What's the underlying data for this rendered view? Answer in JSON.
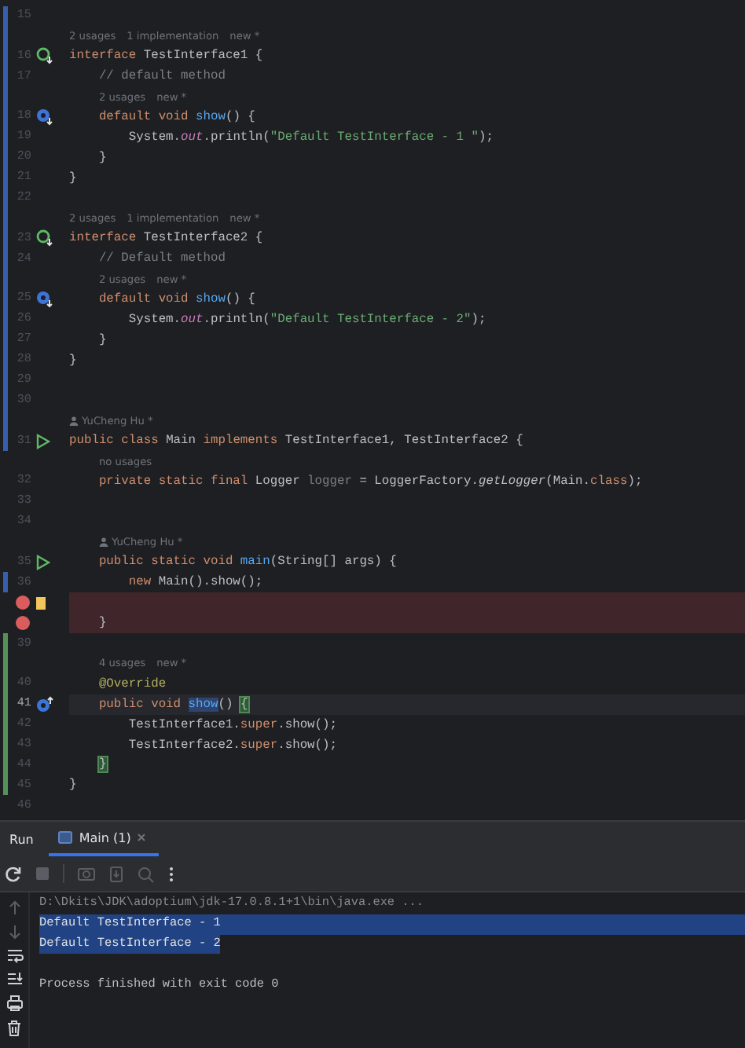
{
  "editor": {
    "lines": [
      {
        "number": "15",
        "modified": true
      },
      {
        "number": "16",
        "modified": true,
        "gutter": {
          "kind": "implemented"
        },
        "hints": [
          {
            "kind": "usage",
            "text": "2 usages"
          },
          {
            "kind": "usage",
            "text": "1 implementation"
          },
          {
            "kind": "usage",
            "text": "new *"
          }
        ],
        "tokens": [
          {
            "text": "interface",
            "kind": "keyword"
          },
          {
            "text": " TestInterface1 {",
            "kind": "plain"
          }
        ]
      },
      {
        "number": "17",
        "modified": true,
        "tokens": [
          {
            "text": "    // default method",
            "kind": "comment"
          }
        ]
      },
      {
        "number": "18",
        "modified": true,
        "gutter": {
          "kind": "method-implemented"
        },
        "hints": [
          {
            "kind": "usage",
            "text": "2 usages"
          },
          {
            "kind": "usage",
            "text": "new *"
          }
        ],
        "tokens": [
          {
            "text": "    default void ",
            "kind": "keyword"
          },
          {
            "text": "show",
            "kind": "declaration"
          },
          {
            "text": "() {",
            "kind": "plain"
          }
        ]
      },
      {
        "number": "19",
        "modified": true,
        "tokens": [
          {
            "text": "        System.",
            "kind": "plain"
          },
          {
            "text": "out",
            "kind": "field"
          },
          {
            "text": ".println(",
            "kind": "plain"
          },
          {
            "text": "\"Default TestInterface - 1 \"",
            "kind": "string"
          },
          {
            "text": ");",
            "kind": "plain"
          }
        ]
      },
      {
        "number": "20",
        "modified": true,
        "tokens": [
          {
            "text": "    }",
            "kind": "plain"
          }
        ]
      },
      {
        "number": "21",
        "modified": true,
        "tokens": [
          {
            "text": "}",
            "kind": "plain"
          }
        ]
      },
      {
        "number": "22",
        "modified": true
      },
      {
        "number": "23",
        "modified": true,
        "gutter": {
          "kind": "implemented"
        },
        "hints": [
          {
            "kind": "usage",
            "text": "2 usages"
          },
          {
            "kind": "usage",
            "text": "1 implementation"
          },
          {
            "kind": "usage",
            "text": "new *"
          }
        ],
        "tokens": [
          {
            "text": "interface",
            "kind": "keyword"
          },
          {
            "text": " TestInterface2 {",
            "kind": "plain"
          }
        ]
      },
      {
        "number": "24",
        "modified": true,
        "tokens": [
          {
            "text": "    // Default method",
            "kind": "comment"
          }
        ]
      },
      {
        "number": "25",
        "modified": true,
        "gutter": {
          "kind": "method-implemented"
        },
        "hints": [
          {
            "kind": "usage",
            "text": "2 usages"
          },
          {
            "kind": "usage",
            "text": "new *"
          }
        ],
        "tokens": [
          {
            "text": "    default void ",
            "kind": "keyword"
          },
          {
            "text": "show",
            "kind": "declaration"
          },
          {
            "text": "() {",
            "kind": "plain"
          }
        ]
      },
      {
        "number": "26",
        "modified": true,
        "tokens": [
          {
            "text": "        System.",
            "kind": "plain"
          },
          {
            "text": "out",
            "kind": "field"
          },
          {
            "text": ".println(",
            "kind": "plain"
          },
          {
            "text": "\"Default TestInterface - 2\"",
            "kind": "string"
          },
          {
            "text": ");",
            "kind": "plain"
          }
        ]
      },
      {
        "number": "27",
        "modified": true,
        "tokens": [
          {
            "text": "    }",
            "kind": "plain"
          }
        ]
      },
      {
        "number": "28",
        "modified": true,
        "tokens": [
          {
            "text": "}",
            "kind": "plain"
          }
        ]
      },
      {
        "number": "29",
        "modified": true
      },
      {
        "number": "30",
        "modified": true
      },
      {
        "number": "31",
        "modified": true,
        "gutter": {
          "kind": "run"
        },
        "hints": [
          {
            "kind": "author",
            "text": "YuCheng Hu *"
          }
        ],
        "tokens": [
          {
            "text": "public class",
            "kind": "keyword"
          },
          {
            "text": " Main ",
            "kind": "plain"
          },
          {
            "text": "implements",
            "kind": "keyword"
          },
          {
            "text": " TestInterface1, TestInterface2 {",
            "kind": "plain"
          }
        ]
      },
      {
        "number": "32",
        "hints": [
          {
            "kind": "usage",
            "text": "no usages"
          }
        ],
        "tokens": [
          {
            "text": "    private static final",
            "kind": "keyword"
          },
          {
            "text": " Logger ",
            "kind": "plain"
          },
          {
            "text": "logger",
            "kind": "unused"
          },
          {
            "text": " = LoggerFactory.",
            "kind": "plain"
          },
          {
            "text": "getLogger",
            "kind": "static"
          },
          {
            "text": "(Main.",
            "kind": "plain"
          },
          {
            "text": "class",
            "kind": "keyword"
          },
          {
            "text": ");",
            "kind": "plain"
          }
        ]
      },
      {
        "number": "33"
      },
      {
        "number": "34"
      },
      {
        "number": "35",
        "gutter": {
          "kind": "run"
        },
        "hints": [
          {
            "kind": "author",
            "text": "YuCheng Hu *"
          }
        ],
        "tokens": [
          {
            "text": "    public static void ",
            "kind": "keyword"
          },
          {
            "text": "main",
            "kind": "declaration"
          },
          {
            "text": "(String[] args) {",
            "kind": "plain"
          }
        ]
      },
      {
        "number": "36",
        "modified": true,
        "tokens": [
          {
            "text": "        new",
            "kind": "keyword"
          },
          {
            "text": " Main().show();",
            "kind": "plain"
          }
        ]
      },
      {
        "breakpoint": true,
        "bookmark": true
      },
      {
        "breakpoint": true,
        "tokens": [
          {
            "text": "    }",
            "kind": "plain"
          }
        ]
      },
      {
        "number": "39",
        "added": true
      },
      {
        "number": "40",
        "added": true,
        "hints": [
          {
            "kind": "usage",
            "text": "4 usages"
          },
          {
            "kind": "usage",
            "text": "new *"
          }
        ],
        "tokens": [
          {
            "text": "    @Override",
            "kind": "annotation"
          }
        ]
      },
      {
        "number": "41",
        "added": true,
        "current": true,
        "gutter": {
          "kind": "override"
        },
        "tokens": [
          {
            "text": "    public void ",
            "kind": "keyword"
          },
          {
            "text": "show",
            "kind": "caret-identifier"
          },
          {
            "text": "() ",
            "kind": "plain"
          },
          {
            "text": "{",
            "kind": "brace-match"
          }
        ]
      },
      {
        "number": "42",
        "added": true,
        "tokens": [
          {
            "text": "        TestInterface1.",
            "kind": "plain"
          },
          {
            "text": "super",
            "kind": "keyword"
          },
          {
            "text": ".show();",
            "kind": "plain"
          }
        ]
      },
      {
        "number": "43",
        "added": true,
        "tokens": [
          {
            "text": "        TestInterface2.",
            "kind": "plain"
          },
          {
            "text": "super",
            "kind": "keyword"
          },
          {
            "text": ".show();",
            "kind": "plain"
          }
        ]
      },
      {
        "number": "44",
        "added": true,
        "tokens": [
          {
            "text": "    }",
            "kind": "brace-match"
          }
        ]
      },
      {
        "number": "45",
        "added": true,
        "tokens": [
          {
            "text": "}",
            "kind": "plain"
          }
        ]
      },
      {
        "number": "46"
      }
    ]
  },
  "run_panel": {
    "title": "Run",
    "tabs": [
      {
        "label": "Main (1)",
        "selected": true
      }
    ],
    "toolbar": [
      {
        "kind": "rerun",
        "disabled": false
      },
      {
        "kind": "stop",
        "disabled": true
      },
      {
        "kind": "camera",
        "disabled": true
      },
      {
        "kind": "export",
        "disabled": true
      },
      {
        "kind": "search",
        "disabled": true
      },
      {
        "kind": "more",
        "disabled": false
      }
    ],
    "side_toolbar": [
      {
        "kind": "up",
        "disabled": true
      },
      {
        "kind": "down",
        "disabled": true
      },
      {
        "kind": "wrap",
        "disabled": false
      },
      {
        "kind": "scroll-end",
        "disabled": false
      },
      {
        "kind": "print",
        "disabled": false
      },
      {
        "kind": "trash",
        "disabled": false
      }
    ],
    "console": [
      {
        "kind": "command",
        "text": "D:\\Dkits\\JDK\\adoptium\\jdk-17.0.8.1+1\\bin\\java.exe ...",
        "selected": false
      },
      {
        "kind": "output",
        "text": "Default TestInterface - 1",
        "selected": true
      },
      {
        "kind": "output",
        "text": "Default TestInterface - 2",
        "selected": true
      },
      {
        "kind": "blank"
      },
      {
        "kind": "output",
        "text": "Process finished with exit code 0",
        "selected": false
      }
    ]
  }
}
